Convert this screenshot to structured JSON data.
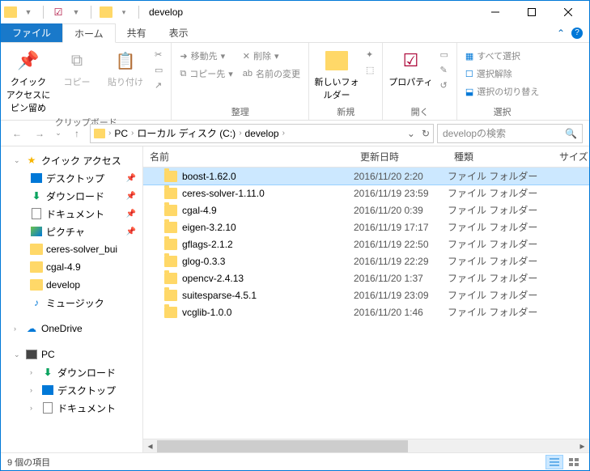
{
  "window": {
    "title": "develop"
  },
  "qat": {
    "dropdown": "▾"
  },
  "tabs": {
    "file": "ファイル",
    "home": "ホーム",
    "share": "共有",
    "view": "表示"
  },
  "ribbon": {
    "clipboard": {
      "pin": "クイック アクセスにピン留め",
      "copy": "コピー",
      "paste": "貼り付け",
      "group_label": "クリップボード"
    },
    "organize": {
      "move_to": "移動先",
      "copy_to": "コピー先",
      "delete": "削除",
      "rename": "名前の変更",
      "group_label": "整理"
    },
    "new": {
      "new_folder": "新しいフォルダー",
      "group_label": "新規"
    },
    "open": {
      "properties": "プロパティ",
      "group_label": "開く"
    },
    "select": {
      "select_all": "すべて選択",
      "select_none": "選択解除",
      "invert": "選択の切り替え",
      "group_label": "選択"
    }
  },
  "address": {
    "crumbs": [
      "PC",
      "ローカル ディスク (C:)",
      "develop"
    ]
  },
  "search": {
    "placeholder": "developの検索"
  },
  "columns": {
    "name": "名前",
    "date": "更新日時",
    "type": "種類",
    "size": "サイズ"
  },
  "files": [
    {
      "name": "boost-1.62.0",
      "date": "2016/11/20 2:20",
      "type": "ファイル フォルダー",
      "selected": true
    },
    {
      "name": "ceres-solver-1.11.0",
      "date": "2016/11/19 23:59",
      "type": "ファイル フォルダー"
    },
    {
      "name": "cgal-4.9",
      "date": "2016/11/20 0:39",
      "type": "ファイル フォルダー"
    },
    {
      "name": "eigen-3.2.10",
      "date": "2016/11/19 17:17",
      "type": "ファイル フォルダー"
    },
    {
      "name": "gflags-2.1.2",
      "date": "2016/11/19 22:50",
      "type": "ファイル フォルダー"
    },
    {
      "name": "glog-0.3.3",
      "date": "2016/11/19 22:29",
      "type": "ファイル フォルダー"
    },
    {
      "name": "opencv-2.4.13",
      "date": "2016/11/20 1:37",
      "type": "ファイル フォルダー"
    },
    {
      "name": "suitesparse-4.5.1",
      "date": "2016/11/19 23:09",
      "type": "ファイル フォルダー"
    },
    {
      "name": "vcglib-1.0.0",
      "date": "2016/11/20 1:46",
      "type": "ファイル フォルダー"
    }
  ],
  "tree": {
    "quick_access": "クイック アクセス",
    "desktop": "デスクトップ",
    "downloads": "ダウンロード",
    "documents": "ドキュメント",
    "pictures": "ピクチャ",
    "ceres": "ceres-solver_bui",
    "cgal": "cgal-4.9",
    "develop": "develop",
    "music": "ミュージック",
    "onedrive": "OneDrive",
    "pc": "PC",
    "pc_downloads": "ダウンロード",
    "pc_desktop": "デスクトップ",
    "pc_documents": "ドキュメント"
  },
  "status": {
    "count": "9 個の項目"
  }
}
